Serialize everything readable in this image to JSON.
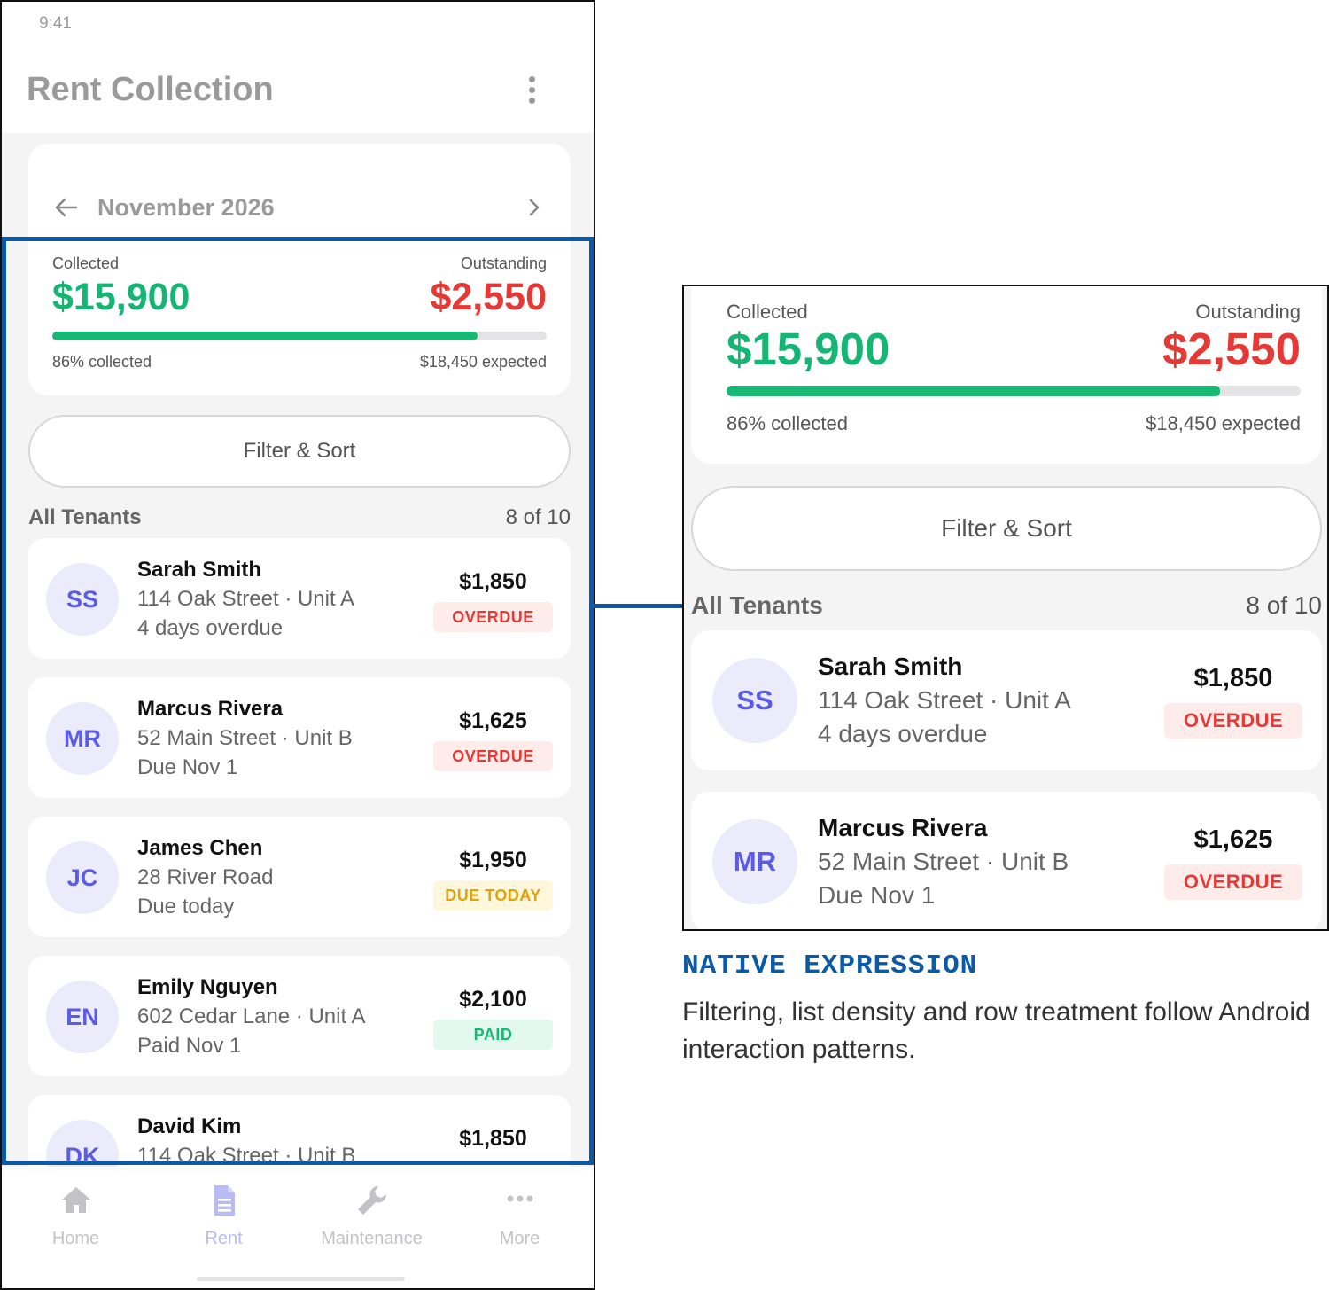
{
  "status_bar": {
    "time": "9:41"
  },
  "app_bar": {
    "title": "Rent Collection",
    "menu_icon": "more-vert-icon"
  },
  "month_selector": {
    "label": "November 2026",
    "prev_icon": "arrow-left-icon",
    "next_icon": "chevron-right-icon"
  },
  "summary": {
    "collected_label": "Collected",
    "collected_value": "$15,900",
    "outstanding_label": "Outstanding",
    "outstanding_value": "$2,550",
    "progress_fraction": 0.86,
    "percent_text": "86% collected",
    "expected_text": "$18,450 expected"
  },
  "filter_button": {
    "label": "Filter & Sort"
  },
  "list": {
    "title": "All Tenants",
    "count": "8 of 10",
    "tenants": [
      {
        "initials": "SS",
        "name": "Sarah Smith",
        "address": "114 Oak Street · Unit A",
        "status_line": "4 days overdue",
        "amount": "$1,850",
        "badge": "OVERDUE"
      },
      {
        "initials": "MR",
        "name": "Marcus Rivera",
        "address": "52 Main Street · Unit B",
        "status_line": "Due Nov 1",
        "amount": "$1,625",
        "badge": "OVERDUE"
      },
      {
        "initials": "JC",
        "name": "James Chen",
        "address": "28 River Road",
        "status_line": "Due today",
        "amount": "$1,950",
        "badge": "DUE TODAY"
      },
      {
        "initials": "EN",
        "name": "Emily Nguyen",
        "address": "602 Cedar Lane · Unit A",
        "status_line": "Paid Nov 1",
        "amount": "$2,100",
        "badge": "PAID"
      },
      {
        "initials": "DK",
        "name": "David Kim",
        "address": "114 Oak Street · Unit B",
        "status_line": "",
        "amount": "$1,850",
        "badge": ""
      }
    ]
  },
  "bottom_nav": {
    "items": [
      {
        "label": "Home",
        "icon": "home-icon"
      },
      {
        "label": "Rent",
        "icon": "document-icon"
      },
      {
        "label": "Maintenance",
        "icon": "wrench-icon"
      },
      {
        "label": "More",
        "icon": "more-horiz-icon"
      }
    ],
    "active": "Rent"
  },
  "caption": {
    "title": "NATIVE EXPRESSION",
    "body": "Filtering, list density and row treatment follow Android interaction patterns."
  },
  "colors": {
    "accent_blue": "#0b5aa8",
    "collected_green": "#15b574",
    "outstanding_red": "#e53935",
    "due_today_amber": "#e0a40c",
    "avatar_text": "#5b5ce6"
  }
}
